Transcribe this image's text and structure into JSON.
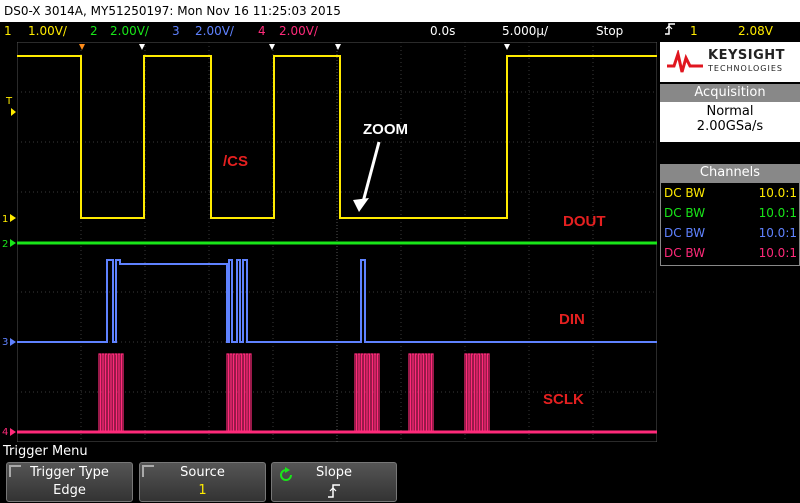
{
  "title": "DS0-X 3014A, MY51250197: Mon Nov 16 11:25:03 2015",
  "channels": [
    {
      "num": "1",
      "scale": "1.00V/",
      "color": "#ffeb00"
    },
    {
      "num": "2",
      "scale": "2.00V/",
      "color": "#19e619"
    },
    {
      "num": "3",
      "scale": "2.00V/",
      "color": "#5f82ff"
    },
    {
      "num": "4",
      "scale": "2.00V/",
      "color": "#ff2a7a"
    }
  ],
  "timebase": {
    "delay": "0.0s",
    "scale": "5.000µ/",
    "state": "Stop"
  },
  "trigger": {
    "source": "1",
    "level": "2.08V",
    "slope_icon": "rising-edge-icon"
  },
  "brand": {
    "name": "KEYSIGHT",
    "sub": "TECHNOLOGIES"
  },
  "acquisition": {
    "header": "Acquisition",
    "mode": "Normal",
    "rate": "2.00GSa/s"
  },
  "channels_panel": {
    "header": "Channels",
    "rows": [
      {
        "coupling": "DC BW",
        "probe": "10.0:1"
      },
      {
        "coupling": "DC BW",
        "probe": "10.0:1"
      },
      {
        "coupling": "DC BW",
        "probe": "10.0:1"
      },
      {
        "coupling": "DC BW",
        "probe": "10.0:1"
      }
    ]
  },
  "annotations": {
    "cs": "/CS",
    "zoom": "ZOOM",
    "dout": "DOUT",
    "din": "DIN",
    "sclk": "SCLK"
  },
  "marker_labels": {
    "trig": "T",
    "c1": "1",
    "c2": "2",
    "c3": "3",
    "c4": "4"
  },
  "menu": {
    "label": "Trigger Menu",
    "softkeys": [
      {
        "top": "Trigger Type",
        "bottom": "Edge"
      },
      {
        "top": "Source",
        "bottom": "1"
      },
      {
        "top": "Slope",
        "bottom": "⮏"
      }
    ]
  },
  "colors": {
    "ch1": "#ffeb00",
    "ch2": "#19e619",
    "ch3": "#5f82ff",
    "ch4": "#ff2a7a",
    "annotation": "#e52020"
  }
}
